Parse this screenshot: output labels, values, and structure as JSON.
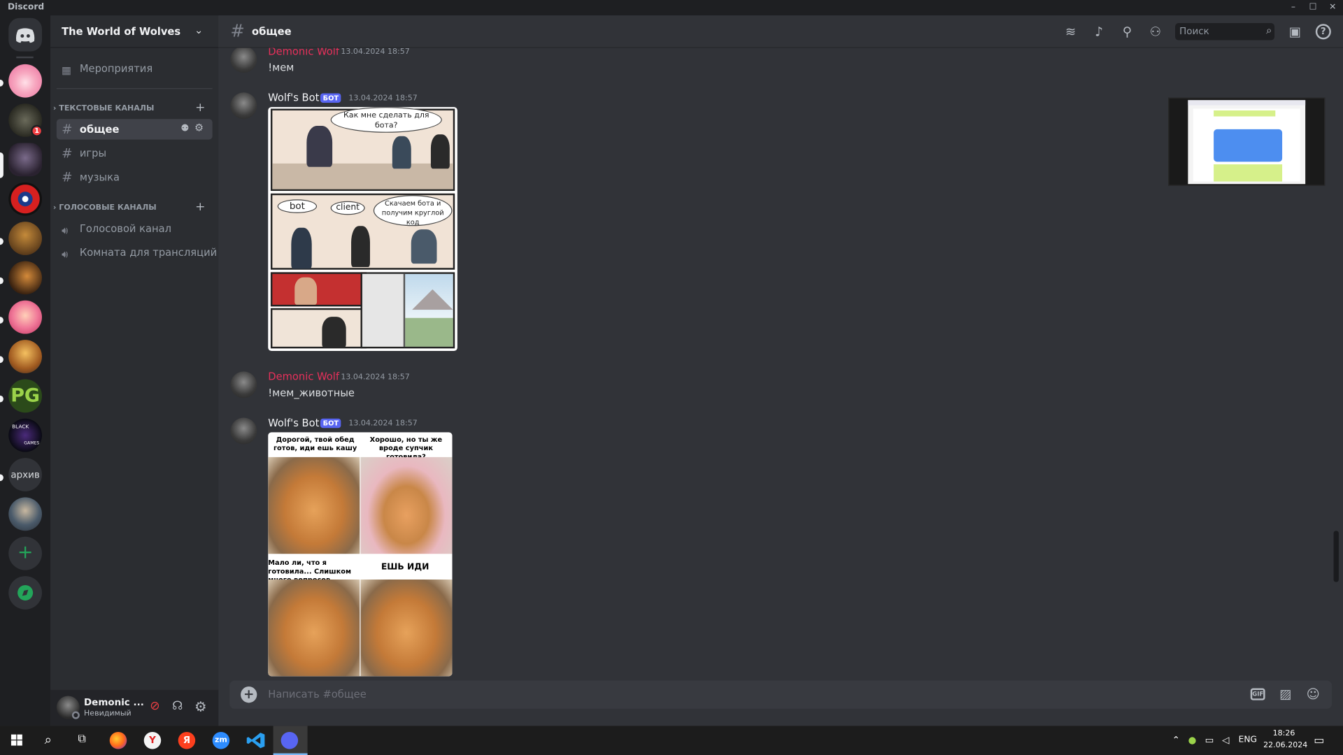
{
  "window": {
    "app_name": "Discord",
    "controls": {
      "minimize": "–",
      "maximize": "☐",
      "close": "✕"
    }
  },
  "servers": {
    "archive_label": "архив",
    "pg_label": "PG",
    "black_label": "BLACK",
    "games_label": "GAMES",
    "mention_count": "1"
  },
  "guild": {
    "name": "The World of Wolves",
    "events_label": "Мероприятия",
    "text_category": "ТЕКСТОВЫЕ КАНАЛЫ",
    "voice_category": "ГОЛОСОВЫЕ КАНАЛЫ",
    "text_channels": [
      {
        "label": "общее"
      },
      {
        "label": "игры"
      },
      {
        "label": "музыка"
      }
    ],
    "voice_channels": [
      {
        "label": "Голосовой канал"
      },
      {
        "label": "Комната для трансляций"
      }
    ]
  },
  "user": {
    "name": "Demonic ...",
    "status": "Невидимый"
  },
  "header": {
    "channel": "общее",
    "search_placeholder": "Поиск",
    "icons": [
      "threads-icon",
      "bell-icon",
      "pin-icon",
      "members-icon",
      "inbox-icon",
      "help-icon"
    ]
  },
  "messages": [
    {
      "author": "Demonic Wolf",
      "timestamp": "13.04.2024 18:57",
      "text": "!мем",
      "author_color": "#e7305b"
    },
    {
      "author": "Wolf's Bot",
      "bot_badge": "БОТ",
      "timestamp": "13.04.2024 18:57",
      "comic": {
        "bubble_top": "Как мне сделать для бота?",
        "bubble_bot": "bot",
        "bubble_client": "client",
        "bubble_long": "Скачаем бота и получим круглой код"
      }
    },
    {
      "author": "Demonic Wolf",
      "timestamp": "13.04.2024 18:57",
      "text": "!мем_животные",
      "author_color": "#e7305b"
    },
    {
      "author": "Wolf's Bot",
      "bot_badge": "БОТ",
      "timestamp": "13.04.2024 18:57",
      "meme": {
        "caption_1": "Дорогой, твой обед готов, иди ешь кашу",
        "caption_2": "Хорошо, но ты же вроде супчик готовила?",
        "caption_3": "Мало ли, что я готовила... Слишком много вопросов",
        "caption_4": "ЕШЬ ИДИ"
      }
    }
  ],
  "composer": {
    "placeholder": "Написать #общее",
    "gif_label": "GIF"
  },
  "taskbar": {
    "language": "ENG",
    "time": "18:26",
    "date": "22.06.2024",
    "zoom_label": "zm",
    "yandex_label": "Я"
  },
  "colors": {
    "accent": "#5865f2",
    "mention_red": "#f23f43",
    "author_red": "#e7305b",
    "add_green": "#23a55a"
  }
}
